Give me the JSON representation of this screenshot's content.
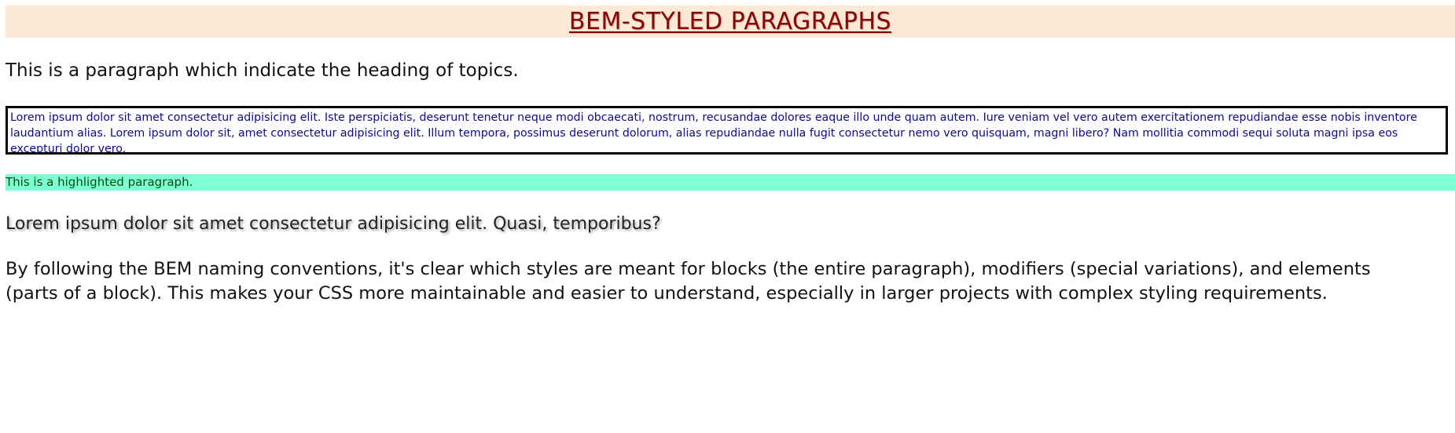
{
  "header": {
    "title": "BEM-STYLED PARAGRAPHS"
  },
  "paragraphs": {
    "topic_heading": "This is a paragraph which indicate the heading of topics.",
    "boxed": "Lorem ipsum dolor sit amet consectetur adipisicing elit. Iste perspiciatis, deserunt tenetur neque modi obcaecati, nostrum, recusandae dolores eaque illo unde quam autem. Iure veniam vel vero autem exercitationem repudiandae esse nobis inventore laudantium alias. Lorem ipsum dolor sit, amet consectetur adipisicing elit. Illum tempora, possimus deserunt dolorum, alias repudiandae nulla fugit consectetur nemo vero quisquam, magni libero? Nam mollitia commodi sequi soluta magni ipsa eos excepturi dolor vero.",
    "highlighted": "This is a highlighted paragraph.",
    "shadowed": "Lorem ipsum dolor sit amet consectetur adipisicing elit. Quasi, temporibus?",
    "closing": "By following the BEM naming conventions, it's clear which styles are meant for blocks (the entire paragraph), modifiers (special variations), and elements (parts of a block). This makes your CSS more maintainable and easier to understand, especially in larger projects with complex styling requirements."
  },
  "colors": {
    "banner_background": "#fbe9d6",
    "banner_text": "#8b0000",
    "boxed_text": "#0a0a8a",
    "boxed_border": "#000000",
    "highlight_background": "#7fffd4",
    "highlight_text": "#0a4d0a"
  }
}
